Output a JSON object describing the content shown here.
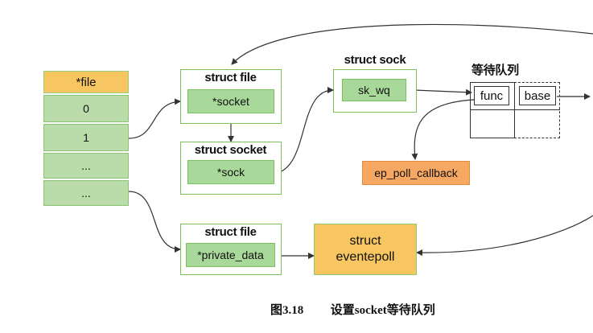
{
  "file_table": {
    "header": "*file",
    "rows": [
      "0",
      "1",
      "...",
      "..."
    ]
  },
  "struct_file_1": {
    "title": "struct file",
    "field": "*socket"
  },
  "struct_socket": {
    "title": "struct socket",
    "field": "*sock"
  },
  "struct_sock": {
    "title": "struct sock",
    "field": "sk_wq"
  },
  "wait_queue": {
    "title": "等待队列",
    "func": "func",
    "base": "base"
  },
  "callback": {
    "label": "ep_poll_callback"
  },
  "struct_file_2": {
    "title": "struct file",
    "field": "*private_data"
  },
  "eventpoll": {
    "line1": "struct",
    "line2": "eventepoll"
  },
  "caption": {
    "figure": "图3.18",
    "text": "设置socket等待队列"
  },
  "colors": {
    "green_cell": "#a9d99a",
    "green_border": "#7cbf5b",
    "file_header": "#f7c661",
    "callback": "#f6a761",
    "eventpoll": "#f7c661",
    "wire": "#333333"
  }
}
